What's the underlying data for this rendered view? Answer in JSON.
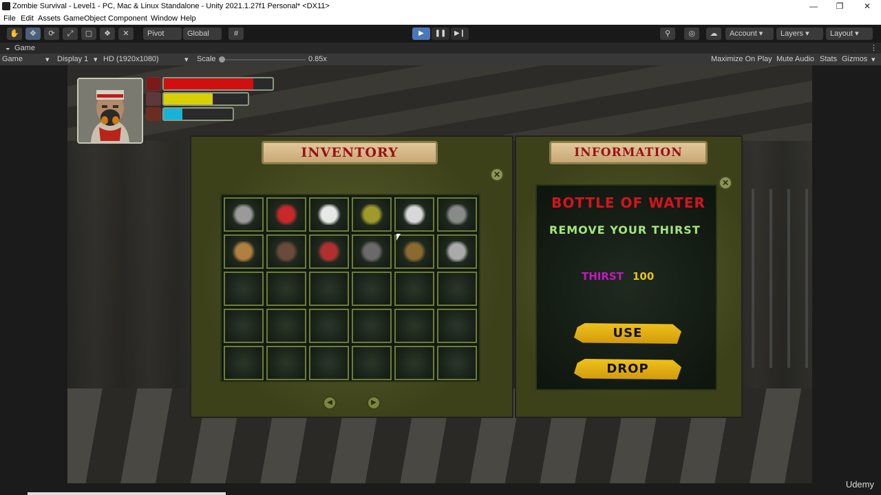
{
  "window": {
    "title": "Zombie Survival - Level1 - PC, Mac & Linux Standalone - Unity 2021.1.27f1 Personal* <DX11>",
    "minimize": "—",
    "restore": "❐",
    "close": "✕"
  },
  "menu": [
    "File",
    "Edit",
    "Assets",
    "GameObject",
    "Component",
    "Window",
    "Help"
  ],
  "toolbar": {
    "pivot": "Pivot",
    "global": "Global",
    "account": "Account",
    "layers": "Layers",
    "layout": "Layout",
    "play_icon": "▶",
    "pause_icon": "❚❚",
    "step_icon": "▶❙"
  },
  "tab": {
    "label": "Game"
  },
  "gamebar": {
    "view": "Game",
    "display": "Display 1",
    "resolution": "HD (1920x1080)",
    "scale_label": "Scale",
    "scale_value": "0.85x",
    "scale_level": 0.0,
    "maximize": "Maximize On Play",
    "mute": "Mute Audio",
    "stats": "Stats",
    "gizmos": "Gizmos"
  },
  "hud": {
    "bars": [
      {
        "name": "health",
        "fill": 0.82,
        "color": "#d01010",
        "icon_color": "#7a1a1a",
        "icon": "heart-icon"
      },
      {
        "name": "hunger",
        "fill": 0.58,
        "color": "#d8d000",
        "icon_color": "#5a3a3a",
        "icon": "food-icon"
      },
      {
        "name": "thirst",
        "fill": 0.27,
        "color": "#18b4d8",
        "icon_color": "#6a2e20",
        "icon": "drink-icon"
      }
    ]
  },
  "inventory": {
    "title": "INVENTORY",
    "close": "✕",
    "prev": "◀",
    "next": "▶",
    "items": [
      {
        "name": "smg-icon",
        "color": "#9a9a9a"
      },
      {
        "name": "canned-food-icon",
        "color": "#c8282a"
      },
      {
        "name": "medkit-icon",
        "color": "#e8e8e8"
      },
      {
        "name": "melon-icon",
        "color": "#9f9a2a"
      },
      {
        "name": "water-bottle-icon",
        "color": "#d8d8d8"
      },
      {
        "name": "magazine-icon",
        "color": "#8a8a8a"
      },
      {
        "name": "ammo-clip-icon",
        "color": "#b08040"
      },
      {
        "name": "bat-icon",
        "color": "#6a4a3a"
      },
      {
        "name": "axe-icon",
        "color": "#b03030"
      },
      {
        "name": "pistol-icon",
        "color": "#6a6a6a"
      },
      {
        "name": "rifle-icon",
        "color": "#8a6a30"
      },
      {
        "name": "shotgun-icon",
        "color": "#aaaaaa"
      }
    ]
  },
  "information": {
    "title": "INFORMATION",
    "close": "✕",
    "item_name": "BOTTLE OF WATER",
    "description": "REMOVE YOUR THIRST",
    "stat_label": "THIRST",
    "stat_value": "100",
    "use": "USE",
    "drop": "DROP"
  },
  "watermark": "Udemy"
}
